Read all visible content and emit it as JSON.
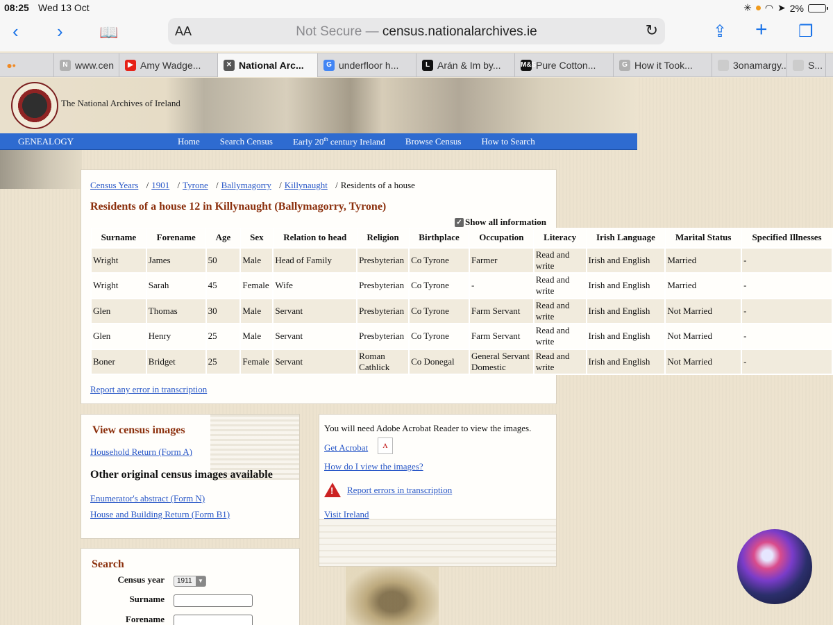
{
  "status_bar": {
    "time": "08:25",
    "date": "Wed 13 Oct",
    "battery": "2%"
  },
  "toolbar": {
    "text_size": "AA",
    "url_prefix": "Not Secure —",
    "url_domain": "census.nationalarchives.ie"
  },
  "tabs": [
    {
      "label": "",
      "favicon": "orange-dots",
      "color": "#f08a24",
      "active": false
    },
    {
      "label": "www.cen",
      "favicon": "N",
      "color": "#b0b0b0",
      "active": false
    },
    {
      "label": "Amy Wadge...",
      "favicon": "▶",
      "color": "#e62117",
      "active": false
    },
    {
      "label": "National Arc...",
      "favicon": "✕",
      "color": "#555555",
      "active": true
    },
    {
      "label": "underfloor h...",
      "favicon": "G",
      "color": "#4285f4",
      "active": false
    },
    {
      "label": "Arán & Im by...",
      "favicon": "L",
      "color": "#111111",
      "active": false
    },
    {
      "label": "Pure Cotton...",
      "favicon": "M&S",
      "color": "#111111",
      "active": false
    },
    {
      "label": "How it Took...",
      "favicon": "G",
      "color": "#b0b0b0",
      "active": false
    },
    {
      "label": "3onamargy...",
      "favicon": "",
      "color": "#cccccc",
      "active": false
    },
    {
      "label": "S...",
      "favicon": "",
      "color": "#cccccc",
      "active": false
    }
  ],
  "site": {
    "logo_text": "The National Archives of Ireland",
    "nav_section": "GENEALOGY",
    "nav": {
      "home": "Home",
      "search": "Search Census",
      "early_a": "Early 20",
      "early_sup": "th",
      "early_b": " century Ireland",
      "browse": "Browse Census",
      "howto": "How to Search"
    }
  },
  "breadcrumb": {
    "years": "Census Years",
    "year": "1901",
    "county": "Tyrone",
    "ded": "Ballymagorry",
    "townland": "Killynaught",
    "current": "Residents of a house",
    "sep": "/"
  },
  "page_title": "Residents of a house 12 in Killynaught (Ballymagorry, Tyrone)",
  "show_all_label": "Show all information",
  "table": {
    "headers": [
      "Surname",
      "Forename",
      "Age",
      "Sex",
      "Relation to head",
      "Religion",
      "Birthplace",
      "Occupation",
      "Literacy",
      "Irish Language",
      "Marital Status",
      "Specified Illnesses"
    ],
    "rows": [
      [
        "Wright",
        "James",
        "50",
        "Male",
        "Head of Family",
        "Presbyterian",
        "Co Tyrone",
        "Farmer",
        "Read and write",
        "Irish and English",
        "Married",
        "-"
      ],
      [
        "Wright",
        "Sarah",
        "45",
        "Female",
        "Wife",
        "Presbyterian",
        "Co Tyrone",
        "-",
        "Read and write",
        "Irish and English",
        "Married",
        "-"
      ],
      [
        "Glen",
        "Thomas",
        "30",
        "Male",
        "Servant",
        "Presbyterian",
        "Co Tyrone",
        "Farm Servant",
        "Read and write",
        "Irish and English",
        "Not Married",
        "-"
      ],
      [
        "Glen",
        "Henry",
        "25",
        "Male",
        "Servant",
        "Presbyterian",
        "Co Tyrone",
        "Farm Servant",
        "Read and write",
        "Irish and English",
        "Not Married",
        "-"
      ],
      [
        "Boner",
        "Bridget",
        "25",
        "Female",
        "Servant",
        "Roman Cathlick",
        "Co Donegal",
        "General Servant Domestic",
        "Read and write",
        "Irish and English",
        "Not Married",
        "-"
      ]
    ]
  },
  "report_error": "Report any error in transcription",
  "images_panel": {
    "title": "View census images",
    "household": "Household Return (Form A)",
    "other_title": "Other original census images available",
    "enumerator": "Enumerator's abstract (Form N)",
    "house_building": "House and Building Return (Form B1)"
  },
  "acrobat_panel": {
    "note": "You will need Adobe Acrobat Reader to view the images.",
    "get_acrobat": "Get Acrobat",
    "how_view": "How do I view the images?",
    "report_errors": "Report errors in transcription",
    "visit": "Visit Ireland"
  },
  "search_panel": {
    "title": "Search",
    "year_label": "Census year",
    "year_value": "1911",
    "surname_label": "Surname",
    "forename_label": "Forename"
  }
}
